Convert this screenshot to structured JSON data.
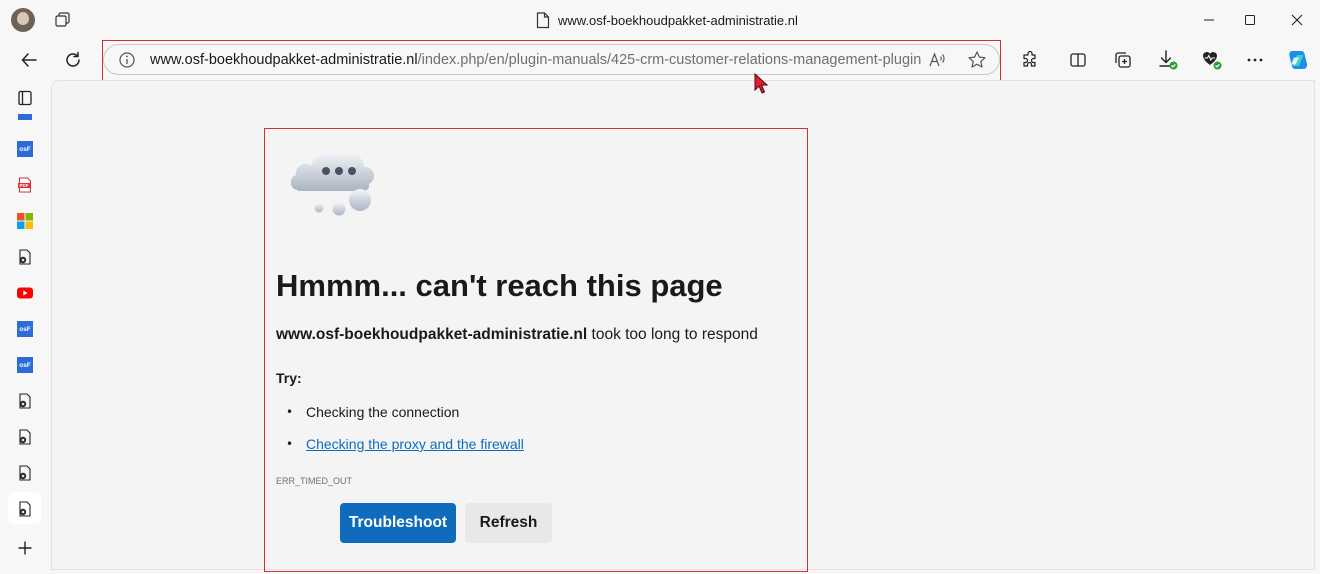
{
  "window": {
    "title": "www.osf-boekhoudpakket-administratie.nl",
    "controls": {
      "minimize": "minimize-icon",
      "maximize": "maximize-icon",
      "close": "close-icon"
    }
  },
  "toolbar": {
    "back": "back-arrow-icon",
    "refresh": "refresh-icon",
    "address": {
      "host": "www.osf-boekhoudpakket-administratie.nl",
      "path": "/index.php/en/plugin-manuals/425-crm-customer-relations-management-plugin"
    },
    "right_icons": [
      "extensions-icon",
      "split-screen-icon",
      "collections-icon",
      "downloads-icon",
      "browser-essentials-icon",
      "more-icon",
      "copilot-icon"
    ]
  },
  "sidebar": {
    "items": [
      {
        "icon": "tab-actions-icon"
      },
      {
        "icon": "osf-favicon",
        "label": "osF"
      },
      {
        "icon": "pdf-icon",
        "label": "PDF"
      },
      {
        "icon": "microsoft-icon"
      },
      {
        "icon": "page-icon"
      },
      {
        "icon": "youtube-icon"
      },
      {
        "icon": "osf-favicon",
        "label": "osF"
      },
      {
        "icon": "osf-favicon",
        "label": "osF"
      },
      {
        "icon": "page-icon"
      },
      {
        "icon": "page-icon"
      },
      {
        "icon": "page-icon"
      },
      {
        "icon": "page-icon"
      },
      {
        "icon": "add-icon"
      }
    ]
  },
  "error": {
    "title": "Hmmm... can't reach this page",
    "host": "www.osf-boekhoudpakket-administratie.nl",
    "message": "took too long to respond",
    "try_label": "Try:",
    "suggestions": [
      "Checking the connection",
      "Checking the proxy and the firewall"
    ],
    "code": "ERR_TIMED_OUT",
    "troubleshoot_label": "Troubleshoot",
    "refresh_label": "Refresh"
  },
  "colors": {
    "accent": "#0f6cbd",
    "highlight_outline": "#d03030"
  }
}
